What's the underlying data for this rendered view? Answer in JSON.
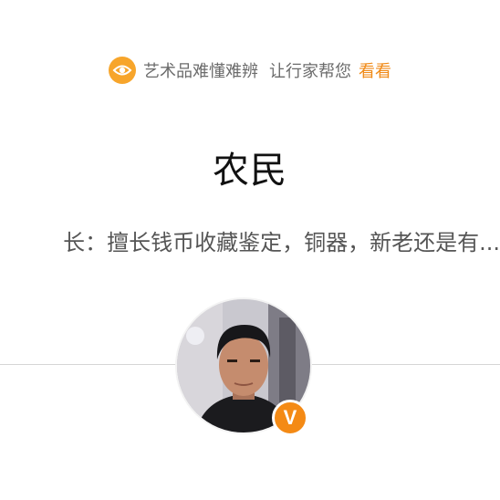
{
  "banner": {
    "icon": "eye-icon",
    "text_part1": "艺术品难懂难辨",
    "text_part2": "让行家帮您",
    "link_label": "看看",
    "colors": {
      "badge": "#f7a52b",
      "link": "#f08a17"
    }
  },
  "profile": {
    "name": "农民",
    "bio": "长：擅长钱币收藏鉴定，铜器，新老还是有...",
    "avatar_icon": "user-photo",
    "verified_label": "V",
    "colors": {
      "verified_badge": "#f48a15"
    }
  }
}
